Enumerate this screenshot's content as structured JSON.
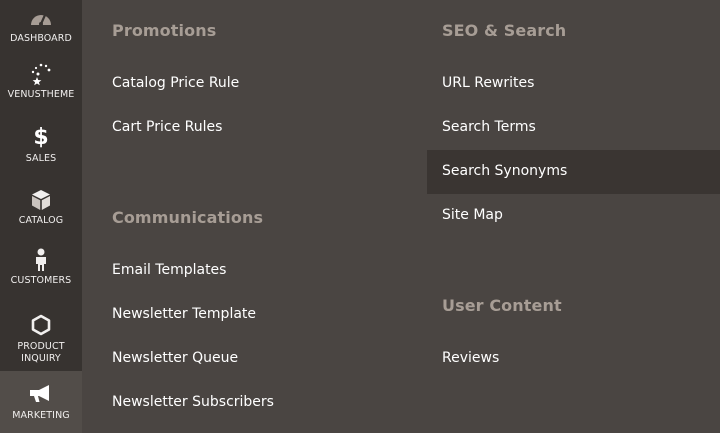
{
  "sidebar": {
    "items": [
      {
        "label": "DASHBOARD",
        "icon": "dashboard-icon"
      },
      {
        "label": "VENUSTHEME",
        "icon": "stars-icon"
      },
      {
        "label": "SALES",
        "icon": "dollar-icon"
      },
      {
        "label": "CATALOG",
        "icon": "box-icon"
      },
      {
        "label": "CUSTOMERS",
        "icon": "person-icon"
      },
      {
        "label_line1": "PRODUCT",
        "label_line2": "INQUIRY",
        "icon": "hexagon-icon"
      },
      {
        "label": "MARKETING",
        "icon": "megaphone-icon",
        "active": true
      }
    ]
  },
  "menu": {
    "promotions": {
      "title": "Promotions",
      "links": [
        "Catalog Price Rule",
        "Cart Price Rules"
      ]
    },
    "communications": {
      "title": "Communications",
      "links": [
        "Email Templates",
        "Newsletter Template",
        "Newsletter Queue",
        "Newsletter Subscribers"
      ]
    },
    "seo": {
      "title": "SEO & Search",
      "links": [
        "URL Rewrites",
        "Search Terms",
        "Search Synonyms",
        "Site Map"
      ]
    },
    "user_content": {
      "title": "User Content",
      "links": [
        "Reviews"
      ]
    }
  },
  "colors": {
    "sidebar_bg": "#373330",
    "panel_bg": "#4a4542",
    "section_title": "#a79d95",
    "hover_row": "#3a3532"
  }
}
